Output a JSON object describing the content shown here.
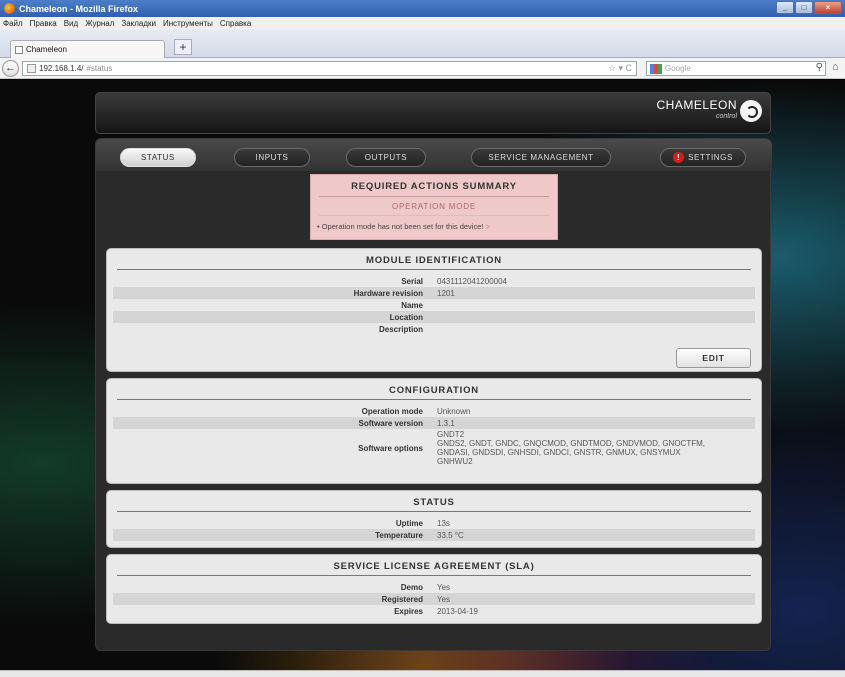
{
  "window": {
    "title": "Chameleon - Mozilla Firefox",
    "controls": [
      "_",
      "□",
      "×"
    ]
  },
  "menu": [
    "Файл",
    "Правка",
    "Вид",
    "Журнал",
    "Закладки",
    "Инструменты",
    "Справка"
  ],
  "browser": {
    "tab_title": "Chameleon",
    "new_tab": "+",
    "url_host": "192.168.1.4/",
    "url_path": "#status",
    "search_placeholder": "Google",
    "back": "←",
    "url_controls": "☆ ▾ C",
    "search_icon": "⚲",
    "home_icon": "⌂"
  },
  "app": {
    "logo_text": "CHAMELEON",
    "logo_sub": "control"
  },
  "nav": {
    "tabs": [
      "STATUS",
      "INPUTS",
      "OUTPUTS",
      "SERVICE MANAGEMENT",
      "SETTINGS"
    ],
    "active": "STATUS",
    "settings_warning": "!"
  },
  "required_actions": {
    "title": "REQUIRED ACTIONS SUMMARY",
    "subtitle": "OPERATION MODE",
    "item": "• Operation mode has not been set for this device!",
    "item_arrow": ">"
  },
  "module_identification": {
    "title": "MODULE IDENTIFICATION",
    "rows": [
      {
        "label": "Serial",
        "value": "0431112041200004"
      },
      {
        "label": "Hardware revision",
        "value": "1201"
      },
      {
        "label": "Name",
        "value": ""
      },
      {
        "label": "Location",
        "value": ""
      },
      {
        "label": "Description",
        "value": ""
      }
    ],
    "edit_label": "EDIT"
  },
  "configuration": {
    "title": "CONFIGURATION",
    "rows": [
      {
        "label": "Operation mode",
        "value": "Unknown"
      },
      {
        "label": "Software version",
        "value": "1.3.1"
      }
    ],
    "software_options_label": "Software options",
    "software_options_lines": [
      "GNDT2",
      "GNDS2, GNDT, GNDC, GNQCMOD, GNDTMOD, GNDVMOD, GNOCTFM,",
      "GNDASI, GNDSDI, GNHSDI, GNDCI, GNSTR, GNMUX, GNSYMUX",
      "GNHWU2"
    ]
  },
  "status": {
    "title": "STATUS",
    "rows": [
      {
        "label": "Uptime",
        "value": "13s"
      },
      {
        "label": "Temperature",
        "value": "33.5 °C"
      }
    ]
  },
  "sla": {
    "title": "SERVICE LICENSE AGREEMENT (SLA)",
    "rows": [
      {
        "label": "Demo",
        "value": "Yes"
      },
      {
        "label": "Registered",
        "value": "Yes"
      },
      {
        "label": "Expires",
        "value": "2013-04-19"
      }
    ]
  }
}
